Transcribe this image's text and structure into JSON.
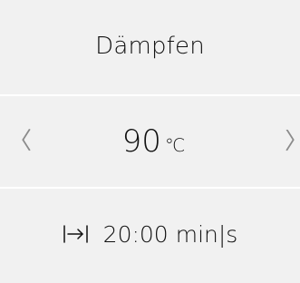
{
  "cooking_panel": {
    "mode_label": "Dämpfen",
    "temperature": {
      "value": "90",
      "unit": "℃"
    },
    "duration": {
      "value": "20:00",
      "unit": "min|s"
    }
  },
  "icons": {
    "decrease": "chevron-left-icon",
    "increase": "chevron-right-icon",
    "duration": "duration-icon"
  },
  "colors": {
    "panel_background": "#f1f1f1",
    "divider": "#ffffff",
    "text": "#111111",
    "arrow": "#8b8b8b"
  }
}
